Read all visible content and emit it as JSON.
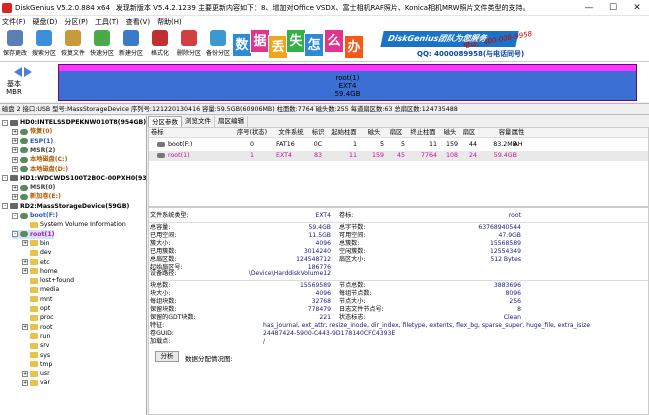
{
  "window": {
    "title_version": "DiskGenius V5.2.0.884 x64",
    "title_note": "发现新版本 V5.4.2.1239 主要更新内容如下：8、增加对Office VSDX、富士相机RAF照片、Konica相机MRW照片文件类型的支持。",
    "btn_minimize": "—",
    "btn_maximize": "☐",
    "btn_close": "✕"
  },
  "menu": [
    "文件(F)",
    "硬盘(D)",
    "分区(P)",
    "工具(T)",
    "查看(V)",
    "帮助(H)"
  ],
  "toolbar": [
    {
      "label": "保存更改",
      "color": "#5a7fb5"
    },
    {
      "label": "搜索分区",
      "color": "#3a8fd8"
    },
    {
      "label": "恢复文件",
      "color": "#c89a3a"
    },
    {
      "label": "快速分区",
      "color": "#4aaa4a"
    },
    {
      "label": "新建分区",
      "color": "#3a7ac8"
    },
    {
      "label": "格式化",
      "color": "#c03030"
    },
    {
      "label": "删除分区",
      "color": "#d04040"
    },
    {
      "label": "备份分区",
      "color": "#3a9ad0"
    }
  ],
  "banner": {
    "tiles": [
      {
        "char": "数",
        "color": "#2d8ad8"
      },
      {
        "char": "据",
        "color": "#e2338d"
      },
      {
        "char": "丢",
        "color": "#f2a51a"
      },
      {
        "char": "失",
        "color": "#33b04a"
      },
      {
        "char": "怎",
        "color": "#2d8ad8"
      },
      {
        "char": "么",
        "color": "#e2338d"
      },
      {
        "char": "办",
        "color": "#f25a1a"
      }
    ],
    "brand": "DiskGenius团队为您服务",
    "phone": "电话：400-008-9958",
    "qq": "QQ: 4000089958(与电话同号)"
  },
  "disk_nav": {
    "basic_label": "基本",
    "mbr_label": "MBR"
  },
  "partition_bar": {
    "name": "root(1)",
    "fs": "EXT4",
    "size": "59.4GB"
  },
  "disk_info": "磁盘 2 接口:USB  型号:MassStorageDevice  序列号:121220130416  容量:59.5GB(60906MB)  柱面数:7764  磁头数:255  每道扇区数:63  总扇区数:124735488",
  "tree": [
    {
      "label": "HD0:INTELSSDPEKNW010T8(954GB)",
      "level": 0,
      "type": "disk",
      "toggle": "-"
    },
    {
      "label": "恢复(0)",
      "level": 1,
      "type": "part",
      "toggle": "+",
      "color": "#b35a00"
    },
    {
      "label": "ESP(1)",
      "level": 1,
      "type": "part",
      "toggle": "+",
      "color": "#2a55c8"
    },
    {
      "label": "MSR(2)",
      "level": 1,
      "type": "part",
      "toggle": "+",
      "color": "#444"
    },
    {
      "label": "本地磁盘(C:)",
      "level": 1,
      "type": "part",
      "toggle": "+",
      "color": "#b35a00"
    },
    {
      "label": "本地磁盘(D:)",
      "level": 1,
      "type": "part",
      "toggle": "+",
      "color": "#b35a00"
    },
    {
      "label": "HD1:WDCWDS100T2B0C-00PXH0(932GB)",
      "level": 0,
      "type": "disk",
      "toggle": "-"
    },
    {
      "label": "MSR(0)",
      "level": 1,
      "type": "part",
      "toggle": "+",
      "color": "#444"
    },
    {
      "label": "新加卷(E:)",
      "level": 1,
      "type": "part",
      "toggle": "+",
      "color": "#b35a00"
    },
    {
      "label": "RD2:MassStorageDevice(59GB)",
      "level": 0,
      "type": "disk",
      "toggle": "-"
    },
    {
      "label": "boot(F:)",
      "level": 1,
      "type": "part",
      "toggle": "-",
      "color": "#2a55c8"
    },
    {
      "label": "System Volume Information",
      "level": 2,
      "type": "folder",
      "toggle": "",
      "color": "#000"
    },
    {
      "label": "root(1)",
      "level": 1,
      "type": "part",
      "toggle": "-",
      "color": "#c3149b",
      "selected": true
    },
    {
      "label": "bin",
      "level": 2,
      "type": "folder",
      "toggle": "+",
      "color": "#000"
    },
    {
      "label": "dev",
      "level": 2,
      "type": "folder",
      "toggle": "",
      "color": "#000"
    },
    {
      "label": "etc",
      "level": 2,
      "type": "folder",
      "toggle": "+",
      "color": "#000"
    },
    {
      "label": "home",
      "level": 2,
      "type": "folder",
      "toggle": "+",
      "color": "#000"
    },
    {
      "label": "lost+found",
      "level": 2,
      "type": "folder",
      "toggle": "",
      "color": "#000"
    },
    {
      "label": "media",
      "level": 2,
      "type": "folder",
      "toggle": "",
      "color": "#000"
    },
    {
      "label": "mnt",
      "level": 2,
      "type": "folder",
      "toggle": "",
      "color": "#000"
    },
    {
      "label": "opt",
      "level": 2,
      "type": "folder",
      "toggle": "",
      "color": "#000"
    },
    {
      "label": "proc",
      "level": 2,
      "type": "folder",
      "toggle": "",
      "color": "#000"
    },
    {
      "label": "root",
      "level": 2,
      "type": "folder",
      "toggle": "+",
      "color": "#000"
    },
    {
      "label": "run",
      "level": 2,
      "type": "folder",
      "toggle": "",
      "color": "#000"
    },
    {
      "label": "srv",
      "level": 2,
      "type": "folder",
      "toggle": "",
      "color": "#000"
    },
    {
      "label": "sys",
      "level": 2,
      "type": "folder",
      "toggle": "",
      "color": "#000"
    },
    {
      "label": "tmp",
      "level": 2,
      "type": "folder",
      "toggle": "",
      "color": "#000"
    },
    {
      "label": "usr",
      "level": 2,
      "type": "folder",
      "toggle": "+",
      "color": "#000"
    },
    {
      "label": "var",
      "level": 2,
      "type": "folder",
      "toggle": "+",
      "color": "#000"
    }
  ],
  "tabs": [
    "分区参数",
    "浏览文件",
    "扇区编辑"
  ],
  "part_table": {
    "headers": [
      "卷标",
      "序号(状态)",
      "文件系统",
      "标识",
      "起始柱面",
      "磁头",
      "扇区",
      "终止柱面",
      "磁头",
      "扇区",
      "容量",
      "属性"
    ],
    "rows": [
      [
        "boot(F:)",
        "0",
        "FAT16",
        "0C",
        "1",
        "5",
        "5",
        "11",
        "159",
        "44",
        "83.2MB",
        "AH"
      ],
      [
        "root(1)",
        "1",
        "EXT4",
        "83",
        "11",
        "159",
        "45",
        "7764",
        "108",
        "24",
        "59.4GB",
        ""
      ]
    ]
  },
  "props": {
    "fs_type_label": "文件系统类型:",
    "fs_type_value": "EXT4",
    "volume_label": "卷标:",
    "volume_value": "root",
    "left": [
      {
        "k": "总容量:",
        "v": "59.4GB"
      },
      {
        "k": "已用空间:",
        "v": "11.5GB"
      },
      {
        "k": "簇大小:",
        "v": "4096"
      },
      {
        "k": "已用簇数:",
        "v": "3014240"
      },
      {
        "k": "总扇区数:",
        "v": "124548712"
      },
      {
        "k": "起始扇区号:",
        "v": "186776"
      }
    ],
    "right": [
      {
        "k": "总字节数:",
        "v": "63768940544"
      },
      {
        "k": "可用空间:",
        "v": "47.9GB"
      },
      {
        "k": "总簇数:",
        "v": "15568589"
      },
      {
        "k": "空闲簇数:",
        "v": "12554349"
      },
      {
        "k": "扇区大小:",
        "v": "512 Bytes"
      }
    ],
    "device_path_label": "设备路径:",
    "device_path_value": "\\Device\\HarddiskVolume12",
    "left2": [
      {
        "k": "块总数:",
        "v": "15569589"
      },
      {
        "k": "块大小:",
        "v": "4096"
      },
      {
        "k": "每组块数:",
        "v": "32768"
      },
      {
        "k": "保留块数:",
        "v": "778479"
      },
      {
        "k": "保留的GDT块数:",
        "v": "221"
      }
    ],
    "right2": [
      {
        "k": "节点总数:",
        "v": "3883696"
      },
      {
        "k": "每组节点数:",
        "v": "8096"
      },
      {
        "k": "节点大小:",
        "v": "256"
      },
      {
        "k": "日志文件节点号:",
        "v": "8"
      },
      {
        "k": "状态标志:",
        "v": "Clean"
      }
    ],
    "features_label": "特征:",
    "features_value": "has_journal, ext_attr, resize_inode, dir_index, filetype, extents, flex_bg, sparse_super, huge_file, extra_isize",
    "uuid_label": "卷GUID:",
    "uuid_value": "24487424-5900-C443-9D178140CFC4393E",
    "mount_label": "加载点:",
    "mount_value": "/",
    "analyze_btn": "分析",
    "analyze_label": "数据分配情况图:"
  }
}
